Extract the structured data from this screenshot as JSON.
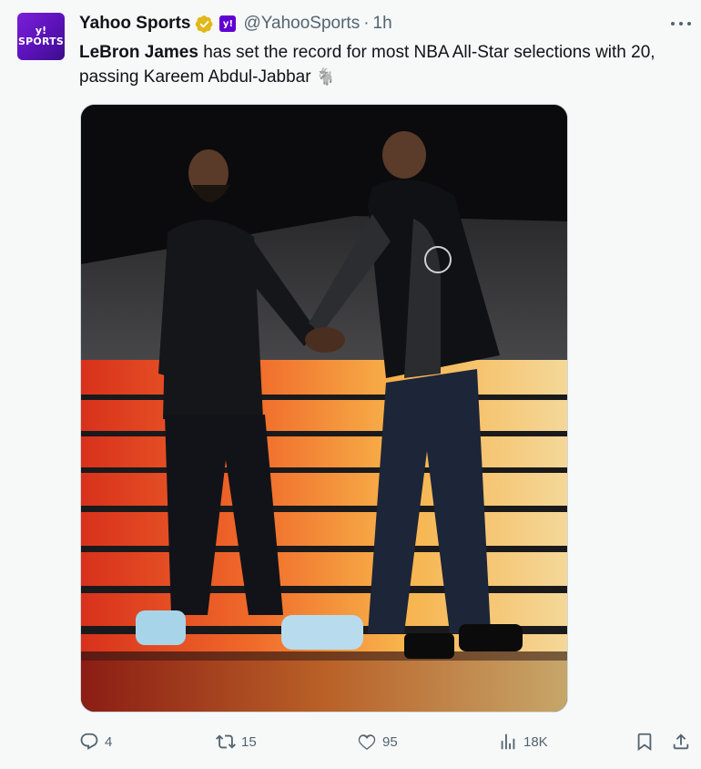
{
  "account": {
    "avatar_text_top": "y!",
    "avatar_text_bottom": "SPORTS",
    "display_name": "Yahoo Sports",
    "affiliate_badge": "y!",
    "handle": "@YahooSports",
    "separator": "·",
    "time": "1h"
  },
  "tweet": {
    "mention": "LeBron James",
    "text_rest": " has set the record for most NBA All-Star selections with 20, passing Kareem Abdul-Jabbar",
    "emoji": "🐐"
  },
  "actions": {
    "replies": "4",
    "reposts": "15",
    "likes": "95",
    "views": "18K"
  },
  "icons": {
    "more": "more-horizontal-icon",
    "verified": "verified-badge-icon",
    "reply": "reply-icon",
    "repost": "repost-icon",
    "like": "heart-icon",
    "views": "views-chart-icon",
    "bookmark": "bookmark-icon",
    "share": "share-icon"
  },
  "colors": {
    "accent_purple": "#6001d2",
    "verified_gold": "#e2b719",
    "text_secondary": "#536471"
  }
}
